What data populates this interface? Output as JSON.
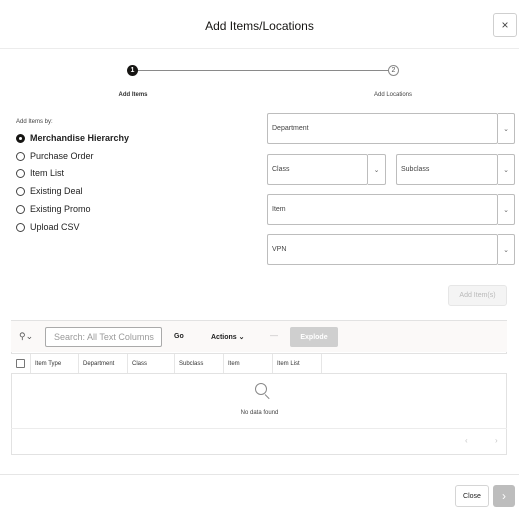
{
  "dialog": {
    "title": "Add Items/Locations",
    "close_glyph": "×"
  },
  "steps": [
    {
      "number": "1",
      "label": "Add Items",
      "state": "current"
    },
    {
      "number": "2",
      "label": "Add Locations",
      "state": "pending"
    }
  ],
  "add_by": {
    "label": "Add Items by:",
    "options": [
      {
        "label": "Merchandise Hierarchy",
        "selected": true
      },
      {
        "label": "Purchase Order",
        "selected": false
      },
      {
        "label": "Item List",
        "selected": false
      },
      {
        "label": "Existing Deal",
        "selected": false
      },
      {
        "label": "Existing Promo",
        "selected": false
      },
      {
        "label": "Upload CSV",
        "selected": false
      }
    ]
  },
  "fields": {
    "department": "Department",
    "class": "Class",
    "subclass": "Subclass",
    "item": "Item",
    "vpn": "VPN",
    "chevron_glyph": "⌄"
  },
  "add_items_button": "Add Item(s)",
  "report": {
    "search_icon": "search-icon",
    "search_placeholder": "Search: All Text Columns",
    "go_label": "Go",
    "actions_label": "Actions",
    "actions_chevron": "⌄",
    "separator": "—",
    "explode_label": "Explode",
    "columns": [
      "Item Type",
      "Department",
      "Class",
      "Subclass",
      "Item",
      "Item List"
    ],
    "no_data": "No data found",
    "prev_glyph": "‹",
    "next_glyph": "›"
  },
  "footer": {
    "close_label": "Close",
    "next_glyph": "›"
  },
  "colors": {
    "primary_text": "#161513",
    "disabled": "#bdbdbd",
    "border": "#bdbdbd"
  }
}
